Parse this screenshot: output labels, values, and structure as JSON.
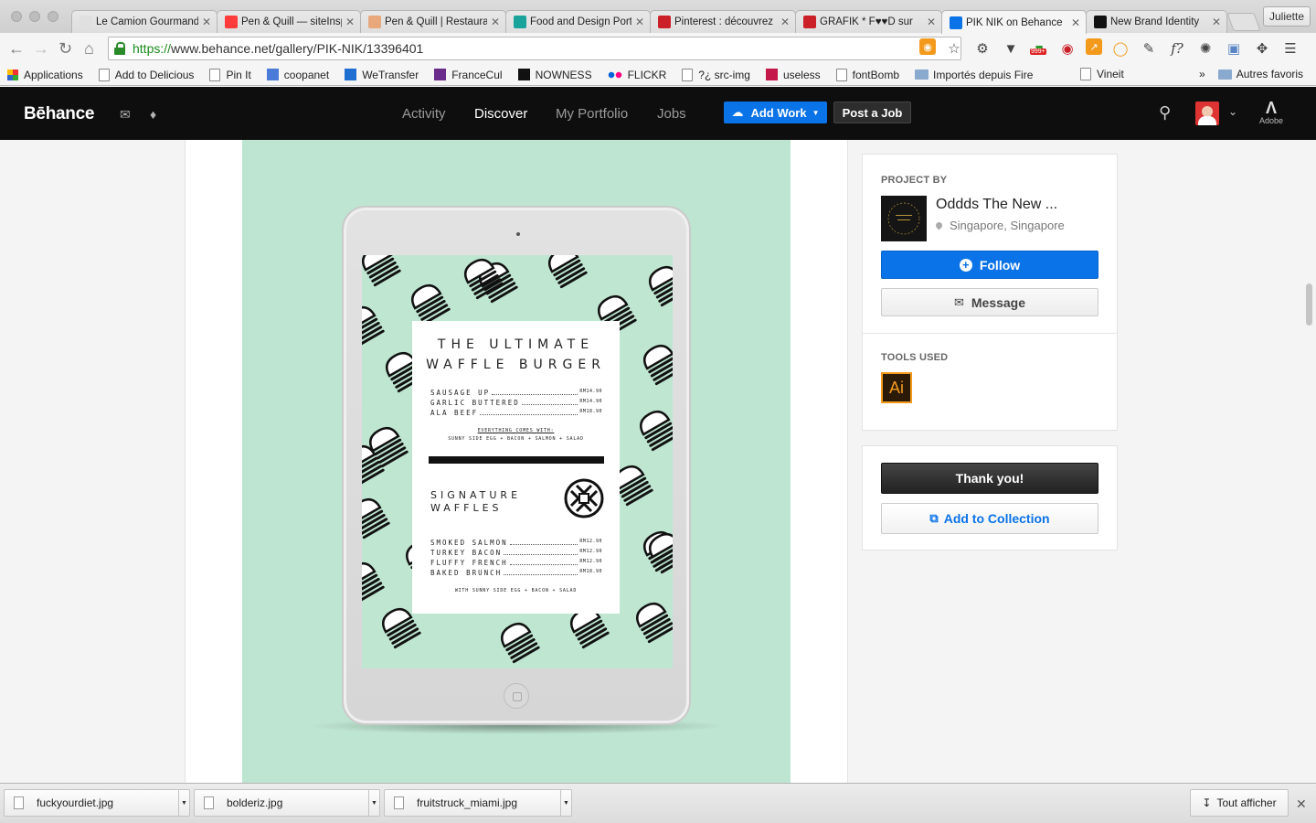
{
  "browser": {
    "tabs": [
      {
        "label": "Le Camion Gourmand",
        "fav": "#e0e0e0"
      },
      {
        "label": "Pen & Quill — siteInspire",
        "fav": "#ff3b3b"
      },
      {
        "label": "Pen & Quill | Restaurant",
        "fav": "#e8a87c"
      },
      {
        "label": "Food and Design Portfolio",
        "fav": "#1aa39a"
      },
      {
        "label": "Pinterest : découvrez",
        "fav": "#cb2027"
      },
      {
        "label": "GRAFIK * F♥♥D sur",
        "fav": "#cb2027"
      },
      {
        "label": "PIK NIK on Behance",
        "fav": "#0a73e8"
      },
      {
        "label": "New Brand Identity",
        "fav": "#111111"
      }
    ],
    "profile": "Juliette",
    "url_scheme": "https://",
    "url_rest": "www.behance.net/gallery/PIK-NIK/13396401",
    "badge": "999+",
    "bookmarks": [
      "Applications",
      "Add to Delicious",
      "Pin It",
      "coopanet",
      "WeTransfer",
      "FranceCul",
      "NOWNESS",
      "FLICKR",
      "?¿ src-img",
      "useless",
      "fontBomb",
      "Importés depuis Fire"
    ],
    "bookmarks_more": "Vineit",
    "bookmarks_chevron": "»",
    "bookmarks_other": "Autres favoris"
  },
  "behance": {
    "logo": "Bēhance",
    "nav": [
      "Activity",
      "Discover",
      "My Portfolio",
      "Jobs"
    ],
    "add_work": "Add Work",
    "post_job": "Post a Job",
    "adobe_label": "Adobe"
  },
  "menu": {
    "title_line1": "THE ULTIMATE",
    "title_line2": "WAFFLE BURGER",
    "items_top": [
      {
        "name": "SAUSAGE UP",
        "price": "RM14.90"
      },
      {
        "name": "GARLIC BUTTERED",
        "price": "RM14.90"
      },
      {
        "name": "ALA BEEF",
        "price": "RM18.90"
      }
    ],
    "everything_heading": "EVERYTHING COMES WITH:",
    "everything_sub": "SUNNY SIDE EGG + BACON + SALMON + SALAD",
    "signature_line1": "SIGNATURE",
    "signature_line2": "WAFFLES",
    "items_bottom": [
      {
        "name": "SMOKED SALMON",
        "price": "RM12.90"
      },
      {
        "name": "TURKEY BACON",
        "price": "RM12.90"
      },
      {
        "name": "FLUFFY FRENCH",
        "price": "RM12.90"
      },
      {
        "name": "BAKED BRUNCH",
        "price": "RM18.90"
      }
    ],
    "bottom_note": "WITH SUNNY SIDE EGG + BACON + SALAD"
  },
  "sidebar": {
    "project_by_label": "PROJECT BY",
    "owner_name": "Oddds The New ...",
    "owner_location": "Singapore, Singapore",
    "follow": "Follow",
    "message": "Message",
    "tools_label": "TOOLS USED",
    "tool_icon_text": "Ai",
    "thank_you": "Thank you!",
    "add_to_collection": "Add to Collection"
  },
  "downloads": {
    "files": [
      "fuckyourdiet.jpg",
      "bolderiz.jpg",
      "fruitstruck_miami.jpg"
    ],
    "show_all": "Tout afficher"
  },
  "colors": {
    "behance_blue": "#0a73e8",
    "artboard_mint": "#bee5d1",
    "header_black": "#0e0e0e"
  }
}
